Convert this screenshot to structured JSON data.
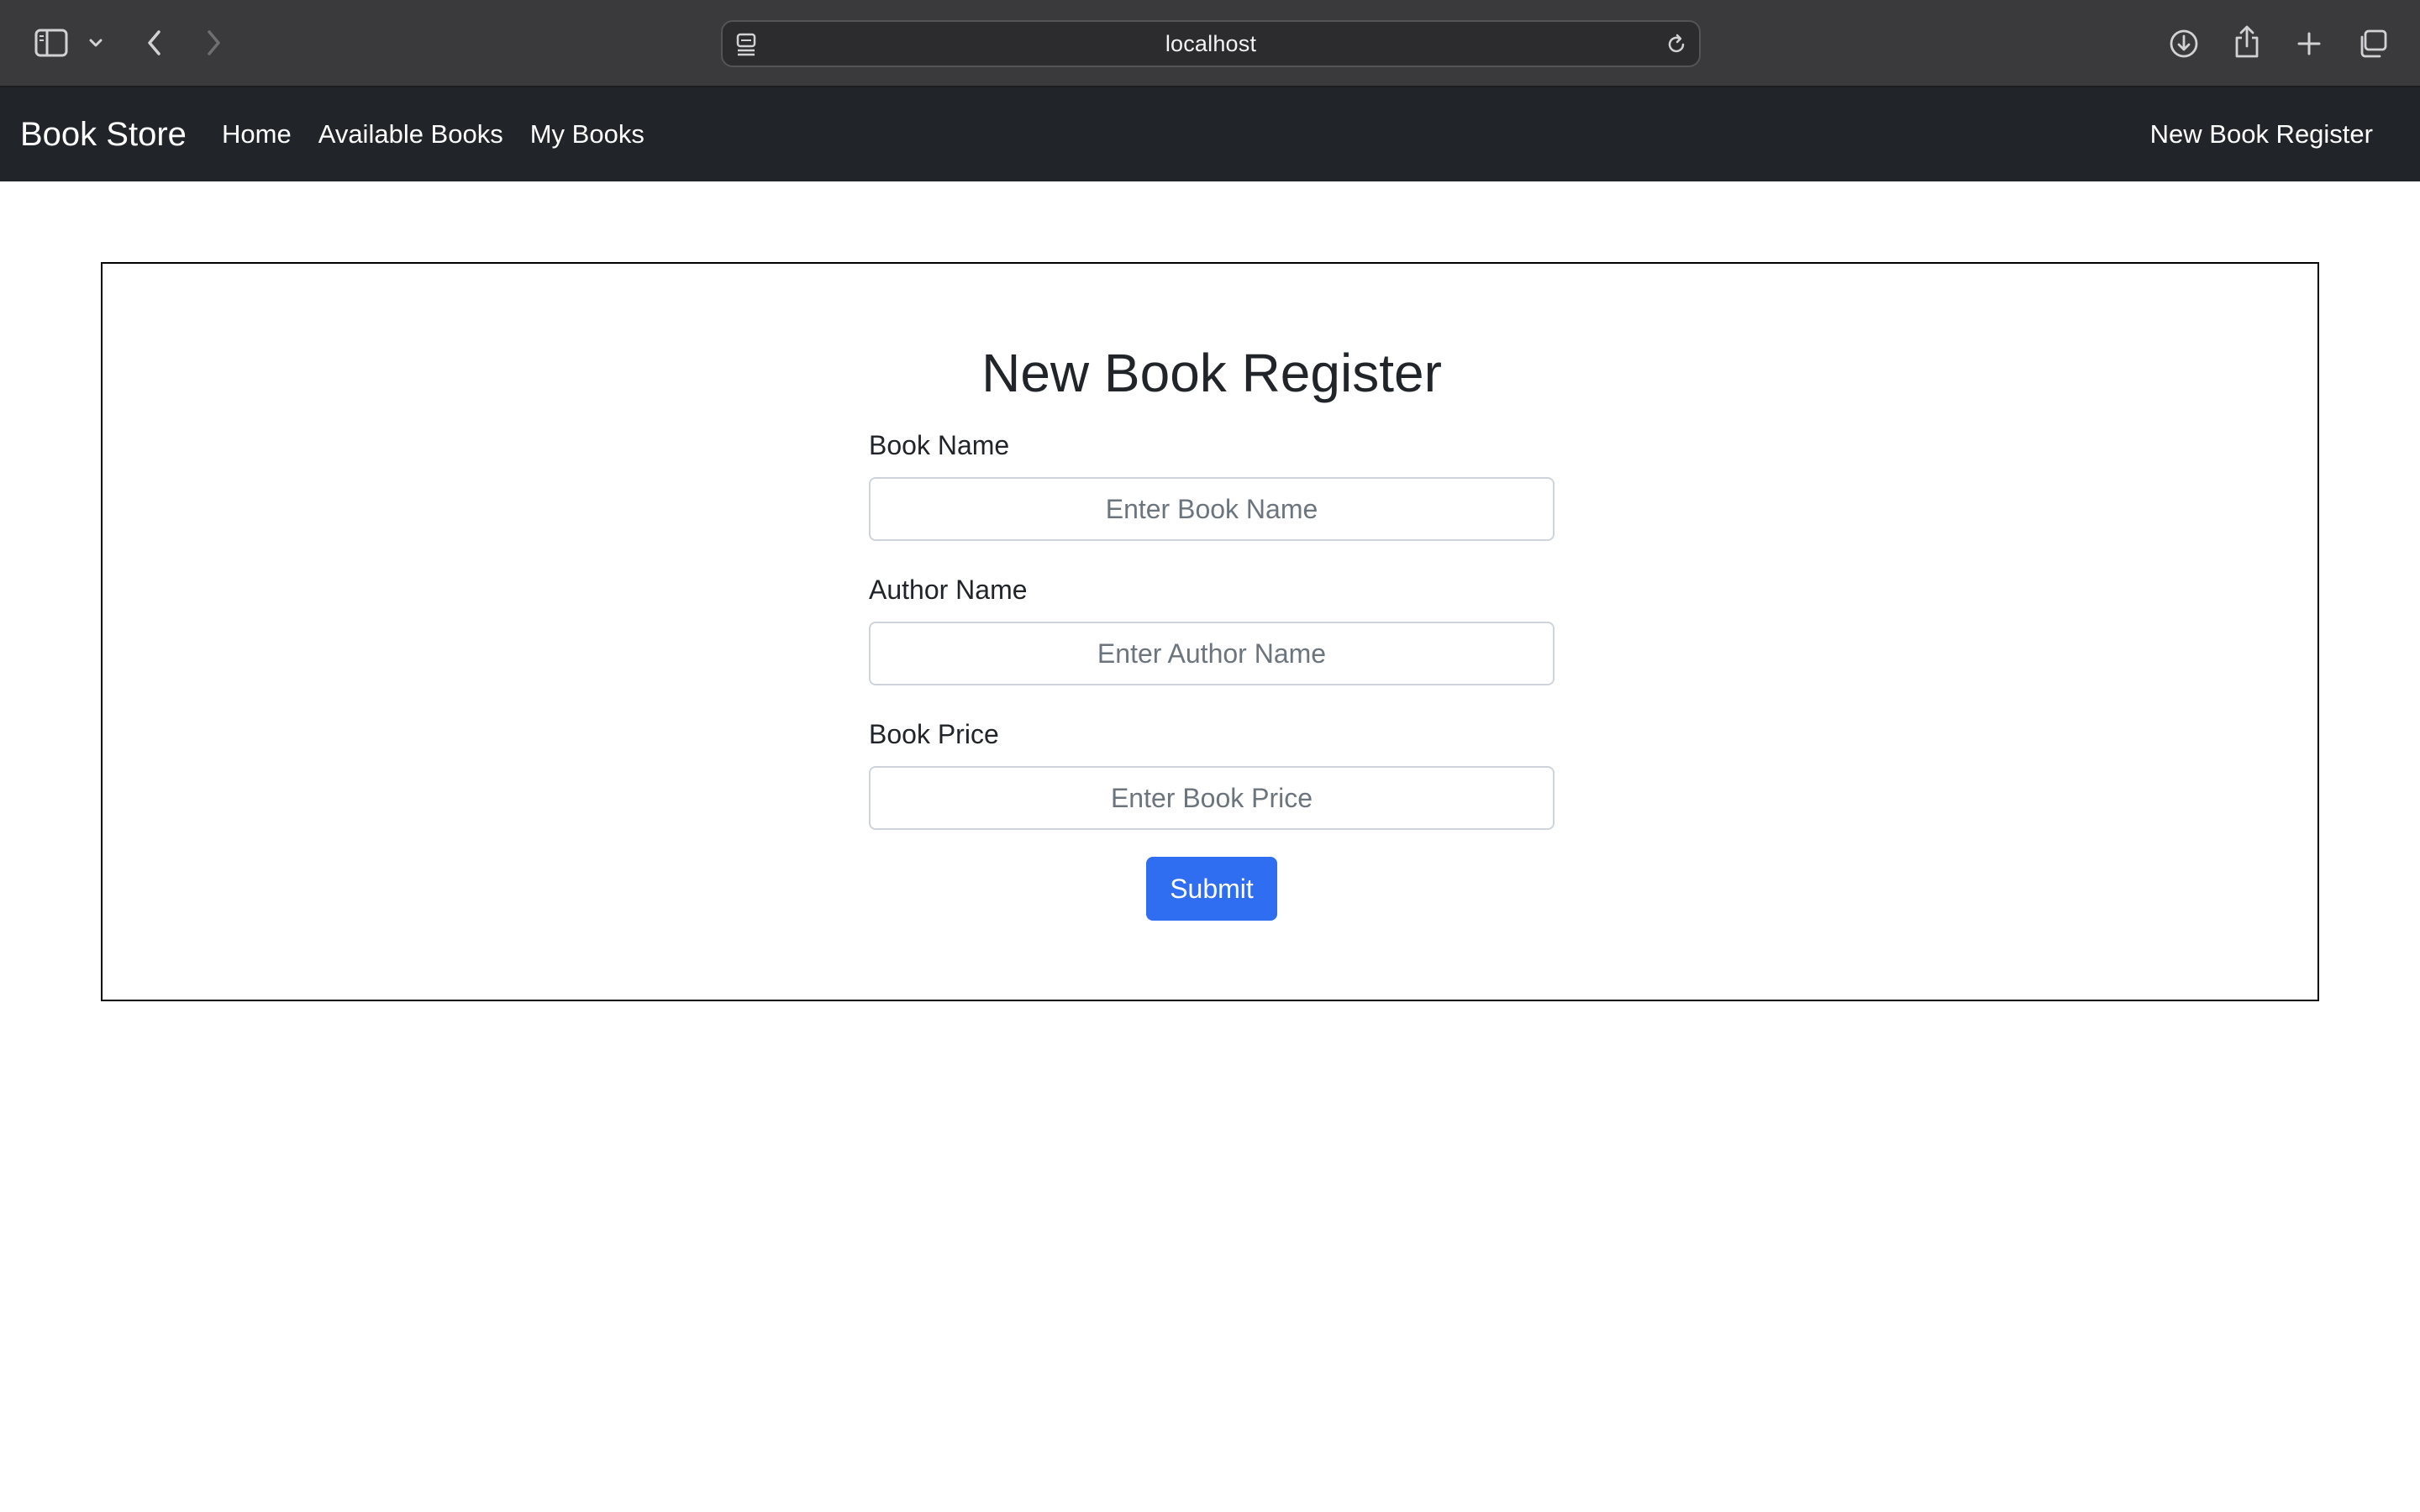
{
  "browser": {
    "url": "localhost",
    "icons": {
      "sidebar": "sidebar-icon",
      "tab_group_menu": "chevron-down-icon",
      "back": "chevron-left-icon",
      "forward": "chevron-right-icon",
      "page_menu": "page-settings-icon",
      "reload": "reload-icon",
      "downloads": "download-icon",
      "share": "share-icon",
      "new_tab": "plus-icon",
      "tab_overview": "tabs-overview-icon"
    }
  },
  "navbar": {
    "brand": "Book Store",
    "links": [
      "Home",
      "Available Books",
      "My Books"
    ],
    "right_link": "New Book Register",
    "background": "#212529"
  },
  "form": {
    "title": "New Book Register",
    "fields": [
      {
        "label": "Book Name",
        "placeholder": "Enter Book Name",
        "value": ""
      },
      {
        "label": "Author Name",
        "placeholder": "Enter Author Name",
        "value": ""
      },
      {
        "label": "Book Price",
        "placeholder": "Enter Book Price",
        "value": ""
      }
    ],
    "submit_label": "Submit",
    "submit_color": "#2f6ef0"
  }
}
